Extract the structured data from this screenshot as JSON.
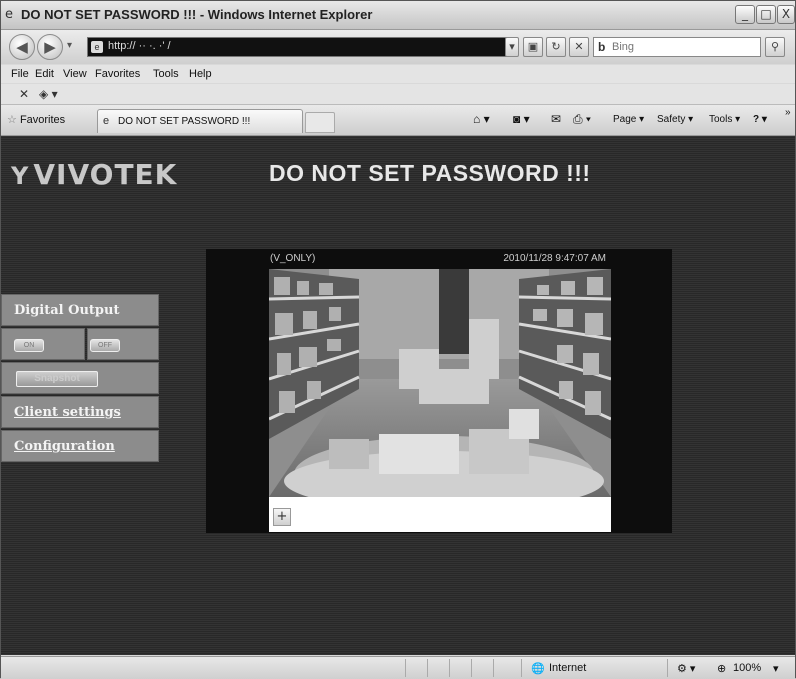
{
  "window": {
    "title": "DO NOT SET PASSWORD !!! - Windows Internet Explorer",
    "min_glyph": "_",
    "max_glyph": "□",
    "close_glyph": "X"
  },
  "address": {
    "url": "http://  ··  ·. ·'   /",
    "back_glyph": "◀",
    "forward_glyph": "▶",
    "dropdown_glyph": "▾",
    "compat_glyph": "▣",
    "refresh_glyph": "↻",
    "stop_glyph": "✕"
  },
  "search": {
    "placeholder": "Bing",
    "icon_glyph": "b",
    "button_glyph": "⚲"
  },
  "menu": [
    "File",
    "Edit",
    "View",
    "Favorites",
    "Tools",
    "Help"
  ],
  "cmdbar1": {
    "close_glyph": "✕",
    "addon_glyph": "◈ ▾"
  },
  "favbar": {
    "favorites_label": "Favorites",
    "tab_title": "DO NOT SET PASSWORD !!!",
    "home_glyph": "⌂ ▾",
    "feeds_glyph": "◙ ▾",
    "mail_glyph": "✉",
    "print_glyph": "⎙ ▾",
    "page_label": "Page ▾",
    "safety_label": "Safety ▾",
    "tools_label": "Tools ▾",
    "help_glyph": "? ▾",
    "more_glyph": "»"
  },
  "page": {
    "logo_text": "VIVOTEK",
    "logo_mark": "Y",
    "title": "DO NOT SET PASSWORD !!!",
    "digital_output_label": "Digital Output",
    "on_label": "ON",
    "off_label": "OFF",
    "snapshot_label": "Snapshot",
    "client_settings_label": "Client settings",
    "configuration_label": "Configuration",
    "stream_label": "(V_ONLY)",
    "timestamp": "2010/11/28 9:47:07 AM",
    "zoom_glyph": "+"
  },
  "status": {
    "zone": "Internet",
    "zone_glyph": "🌐",
    "protect_glyph": "⚙ ▾",
    "zoom": "100%",
    "zoom_glyph": "⊕",
    "zoom_dropdown": "▾"
  }
}
